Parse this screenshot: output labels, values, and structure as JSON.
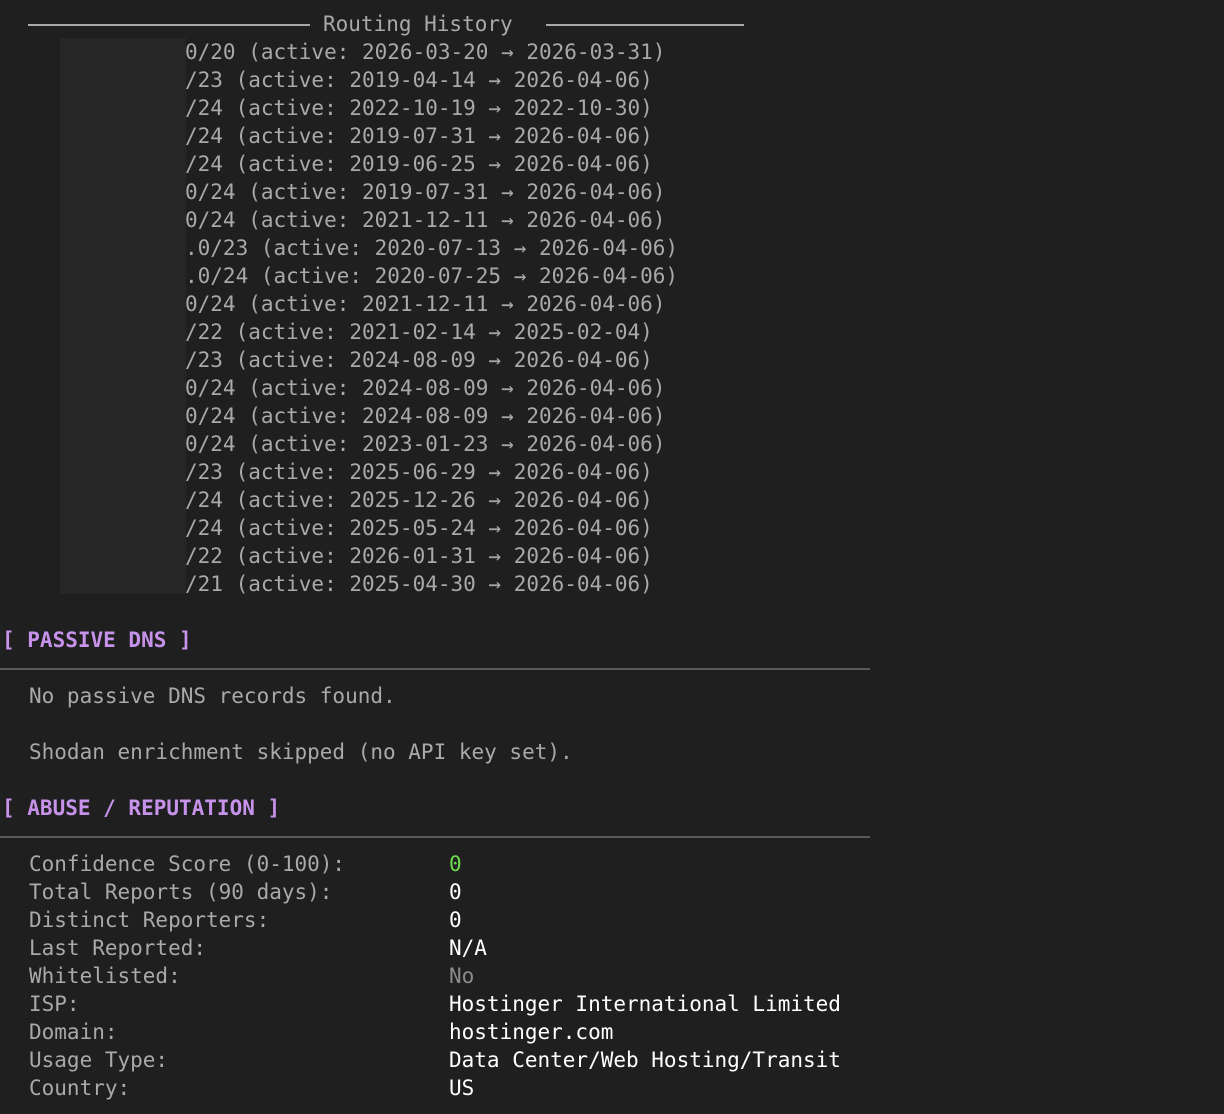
{
  "routing_history": {
    "title": "Routing History",
    "rows": [
      "0/20 (active: 2026-03-20 → 2026-03-31)",
      "/23 (active: 2019-04-14 → 2026-04-06)",
      "/24 (active: 2022-10-19 → 2022-10-30)",
      "/24 (active: 2019-07-31 → 2026-04-06)",
      "/24 (active: 2019-06-25 → 2026-04-06)",
      "0/24 (active: 2019-07-31 → 2026-04-06)",
      "0/24 (active: 2021-12-11 → 2026-04-06)",
      ".0/23 (active: 2020-07-13 → 2026-04-06)",
      ".0/24 (active: 2020-07-25 → 2026-04-06)",
      "0/24 (active: 2021-12-11 → 2026-04-06)",
      "/22 (active: 2021-02-14 → 2025-02-04)",
      "/23 (active: 2024-08-09 → 2026-04-06)",
      "0/24 (active: 2024-08-09 → 2026-04-06)",
      "0/24 (active: 2024-08-09 → 2026-04-06)",
      "0/24 (active: 2023-01-23 → 2026-04-06)",
      "/23 (active: 2025-06-29 → 2026-04-06)",
      "/24 (active: 2025-12-26 → 2026-04-06)",
      "/24 (active: 2025-05-24 → 2026-04-06)",
      "/22 (active: 2026-01-31 → 2026-04-06)",
      "/21 (active: 2025-04-30 → 2026-04-06)"
    ]
  },
  "passive_dns": {
    "header": "[ PASSIVE DNS ]",
    "message": "No passive DNS records found.",
    "shodan_message": "Shodan enrichment skipped (no API key set)."
  },
  "abuse": {
    "header": "[ ABUSE / REPUTATION ]",
    "fields": [
      {
        "label": "Confidence Score (0-100):",
        "value": "0"
      },
      {
        "label": "Total Reports (90 days):",
        "value": "0"
      },
      {
        "label": "Distinct Reporters:",
        "value": "0"
      },
      {
        "label": "Last Reported:",
        "value": "N/A"
      },
      {
        "label": "Whitelisted:",
        "value": "No"
      },
      {
        "label": "ISP:",
        "value": "Hostinger International Limited"
      },
      {
        "label": "Domain:",
        "value": "hostinger.com"
      },
      {
        "label": "Usage Type:",
        "value": "Data Center/Web Hosting/Transit"
      },
      {
        "label": "Country:",
        "value": "US"
      }
    ]
  },
  "colors": {
    "background": "#1f1f1f",
    "text": "#a9a9a9",
    "section_header": "#c792ea",
    "value": "#ffffff",
    "score_ok": "#6bdc4d",
    "muted": "#8b8b8b"
  }
}
